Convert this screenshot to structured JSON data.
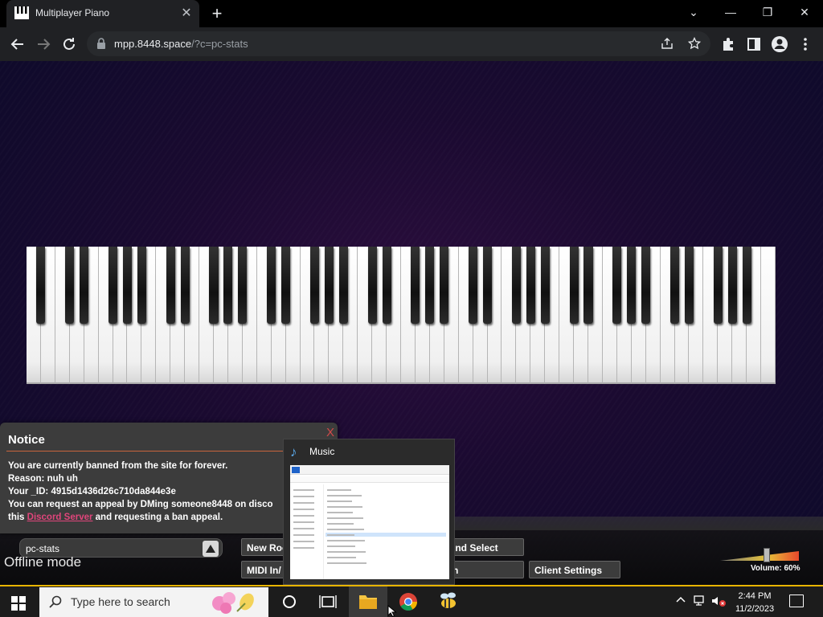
{
  "browser": {
    "tab_title": "Multiplayer Piano",
    "tab_close": "✕",
    "new_tab": "+",
    "url_host": "mpp.8448.space",
    "url_path": "/?c=pc-stats",
    "window_controls": {
      "dropdown": "⌄",
      "minimize": "—",
      "restore": "❐",
      "close": "✕"
    }
  },
  "notice": {
    "title": "Notice",
    "close": "X",
    "line1": "You are currently banned from the site for forever.",
    "line2": "Reason: nuh uh",
    "line3": "Your _ID: 4915d1436d26c710da844e3e",
    "line4": "You can request an appeal by DMing someone8448 on discord o",
    "line5_pre": "this ",
    "line5_link": "Discord Server",
    "line5_post": " and requesting a ban appeal."
  },
  "bottom": {
    "room_name": "pc-stats",
    "offline": "Offline mode",
    "new_room": "New Roo",
    "midi": "MIDI In/",
    "sound_select": "und Select",
    "synth": "th",
    "client_settings": "Client Settings",
    "volume_label": "Volume: 60%",
    "volume_value": 0.6
  },
  "thumbnail": {
    "title": "Music"
  },
  "taskbar": {
    "search_placeholder": "Type here to search",
    "time": "2:44 PM",
    "date": "11/2/2023"
  },
  "colors": {
    "accent_link": "#e0457b",
    "taskbar_accent": "#e8b400",
    "notice_rule": "#c8643c"
  }
}
